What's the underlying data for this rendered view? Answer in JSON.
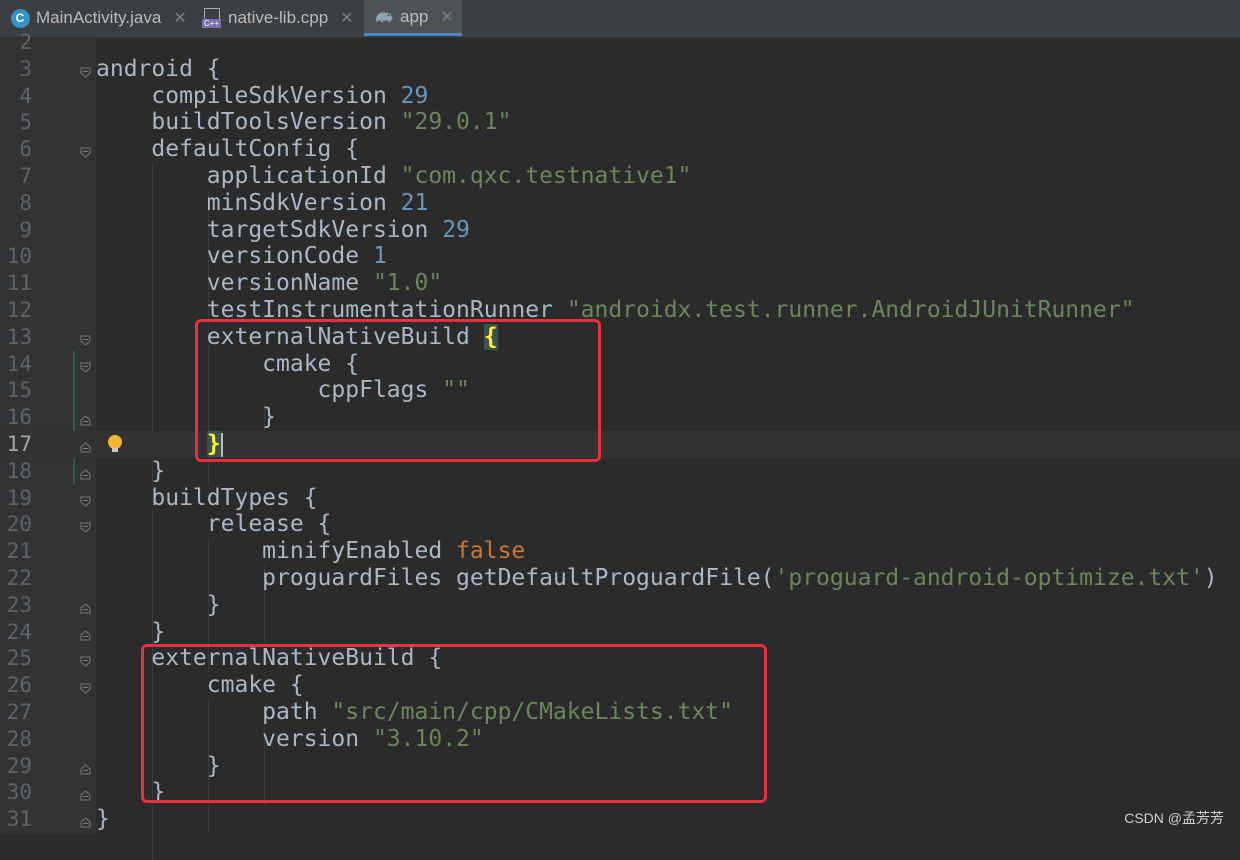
{
  "tabs": [
    {
      "label": "MainActivity.java",
      "icon": "java-class-icon",
      "icon_text": "C",
      "active": false
    },
    {
      "label": "native-lib.cpp",
      "icon": "cpp-file-icon",
      "icon_text": "C++",
      "active": false
    },
    {
      "label": "app",
      "icon": "gradle-elephant-icon",
      "active": true
    }
  ],
  "editor": {
    "lines": [
      {
        "n": "2"
      },
      {
        "n": "3",
        "parts": [
          {
            "t": "android {"
          }
        ]
      },
      {
        "n": "4",
        "parts": [
          {
            "t": "    compileSdkVersion "
          },
          {
            "t": "29",
            "c": "num"
          }
        ]
      },
      {
        "n": "5",
        "parts": [
          {
            "t": "    buildToolsVersion "
          },
          {
            "t": "\"29.0.1\"",
            "c": "str"
          }
        ]
      },
      {
        "n": "6",
        "parts": [
          {
            "t": "    defaultConfig {"
          }
        ]
      },
      {
        "n": "7",
        "parts": [
          {
            "t": "        applicationId "
          },
          {
            "t": "\"com.qxc.testnative1\"",
            "c": "str"
          }
        ]
      },
      {
        "n": "8",
        "parts": [
          {
            "t": "        minSdkVersion "
          },
          {
            "t": "21",
            "c": "num"
          }
        ]
      },
      {
        "n": "9",
        "parts": [
          {
            "t": "        targetSdkVersion "
          },
          {
            "t": "29",
            "c": "num"
          }
        ]
      },
      {
        "n": "10",
        "parts": [
          {
            "t": "        versionCode "
          },
          {
            "t": "1",
            "c": "num"
          }
        ]
      },
      {
        "n": "11",
        "parts": [
          {
            "t": "        versionName "
          },
          {
            "t": "\"1.0\"",
            "c": "str"
          }
        ]
      },
      {
        "n": "12",
        "parts": [
          {
            "t": "        testInstrumentationRunner "
          },
          {
            "t": "\"androidx.test.runner.AndroidJUnitRunner\"",
            "c": "str"
          }
        ]
      },
      {
        "n": "13",
        "parts": [
          {
            "t": "        externalNativeBuild "
          },
          {
            "t": "{",
            "c": "hl"
          }
        ]
      },
      {
        "n": "14",
        "parts": [
          {
            "t": "            cmake {"
          }
        ]
      },
      {
        "n": "15",
        "parts": [
          {
            "t": "                cppFlags "
          },
          {
            "t": "\"\"",
            "c": "str"
          }
        ]
      },
      {
        "n": "16",
        "parts": [
          {
            "t": "            }"
          }
        ]
      },
      {
        "n": "17",
        "parts": [
          {
            "t": "        "
          },
          {
            "t": "}",
            "c": "hl"
          },
          {
            "t": "",
            "c": "caret"
          }
        ]
      },
      {
        "n": "18",
        "parts": [
          {
            "t": "    }"
          }
        ]
      },
      {
        "n": "19",
        "parts": [
          {
            "t": "    buildTypes {"
          }
        ]
      },
      {
        "n": "20",
        "parts": [
          {
            "t": "        release {"
          }
        ]
      },
      {
        "n": "21",
        "parts": [
          {
            "t": "            minifyEnabled "
          },
          {
            "t": "false",
            "c": "kw"
          }
        ]
      },
      {
        "n": "22",
        "parts": [
          {
            "t": "            proguardFiles getDefaultProguardFile("
          },
          {
            "t": "'proguard-android-optimize.txt'",
            "c": "str"
          },
          {
            "t": ")"
          }
        ]
      },
      {
        "n": "23",
        "parts": [
          {
            "t": "        }"
          }
        ]
      },
      {
        "n": "24",
        "parts": [
          {
            "t": "    }"
          }
        ]
      },
      {
        "n": "25",
        "parts": [
          {
            "t": "    externalNativeBuild {"
          }
        ]
      },
      {
        "n": "26",
        "parts": [
          {
            "t": "        cmake {"
          }
        ]
      },
      {
        "n": "27",
        "parts": [
          {
            "t": "            path "
          },
          {
            "t": "\"src/main/cpp/CMakeLists.txt\"",
            "c": "str"
          }
        ]
      },
      {
        "n": "28",
        "parts": [
          {
            "t": "            version "
          },
          {
            "t": "\"3.10.2\"",
            "c": "str"
          }
        ]
      },
      {
        "n": "29",
        "parts": [
          {
            "t": "        }"
          }
        ]
      },
      {
        "n": "30",
        "parts": [
          {
            "t": "    }"
          }
        ]
      },
      {
        "n": "31",
        "parts": [
          {
            "t": "}"
          }
        ]
      }
    ],
    "current_line": "17",
    "fold_open_lines": [
      "3",
      "6",
      "13",
      "14",
      "19",
      "20",
      "25",
      "26"
    ],
    "fold_close_lines": [
      "16",
      "17",
      "18",
      "23",
      "24",
      "29",
      "30",
      "31"
    ],
    "intention_bulb_line": "17"
  },
  "colors": {
    "background": "#2b2b2b",
    "number": "#6897bb",
    "string": "#6a8759",
    "keyword": "#cc7832",
    "highlight_box": "#e8303f"
  },
  "watermark": "CSDN @孟芳芳"
}
